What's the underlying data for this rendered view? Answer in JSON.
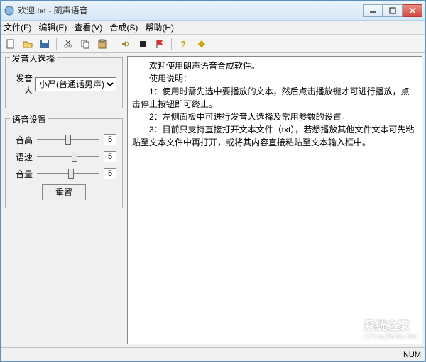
{
  "window": {
    "title": "欢迎.txt - 朗声语音"
  },
  "menu": {
    "file": "文件(F)",
    "edit": "编辑(E)",
    "view": "查看(V)",
    "synth": "合成(S)",
    "help": "帮助(H)"
  },
  "toolbar_icons": {
    "new": "new-file-icon",
    "open": "open-folder-icon",
    "save": "save-icon",
    "cut": "cut-icon",
    "copy": "copy-icon",
    "paste": "paste-icon",
    "play": "play-sound-icon",
    "stop": "stop-icon",
    "flag": "flag-icon",
    "help": "help-icon",
    "about": "about-icon"
  },
  "voice_panel": {
    "legend": "发音人选择",
    "label": "发音人",
    "selected": "小严(普通话男声)"
  },
  "audio_panel": {
    "legend": "语音设置",
    "pitch_label": "音高",
    "speed_label": "语速",
    "volume_label": "音量",
    "pitch_value": "5",
    "speed_value": "5",
    "volume_value": "5",
    "reset_label": "重置"
  },
  "slider_positions": {
    "pitch_pct": 50,
    "speed_pct": 60,
    "volume_pct": 55
  },
  "main_text": "　　欢迎使用朗声语音合成软件。\n　　使用说明：\n　　1：使用时需先选中要播放的文本，然后点击播放键才可进行播放，点击停止按钮即可终止。\n　　2：左侧面板中可进行发音人选择及常用参数的设置。\n　　3：目前只支持直接打开文本文件（txt），若想播放其他文件文本可先粘贴至文本文件中再打开，或将其内容直接粘贴至文本输入框中。",
  "statusbar": {
    "num": "NUM"
  },
  "watermark": {
    "text": "系统之家",
    "sub": "XiTongZhiJia.Net"
  }
}
